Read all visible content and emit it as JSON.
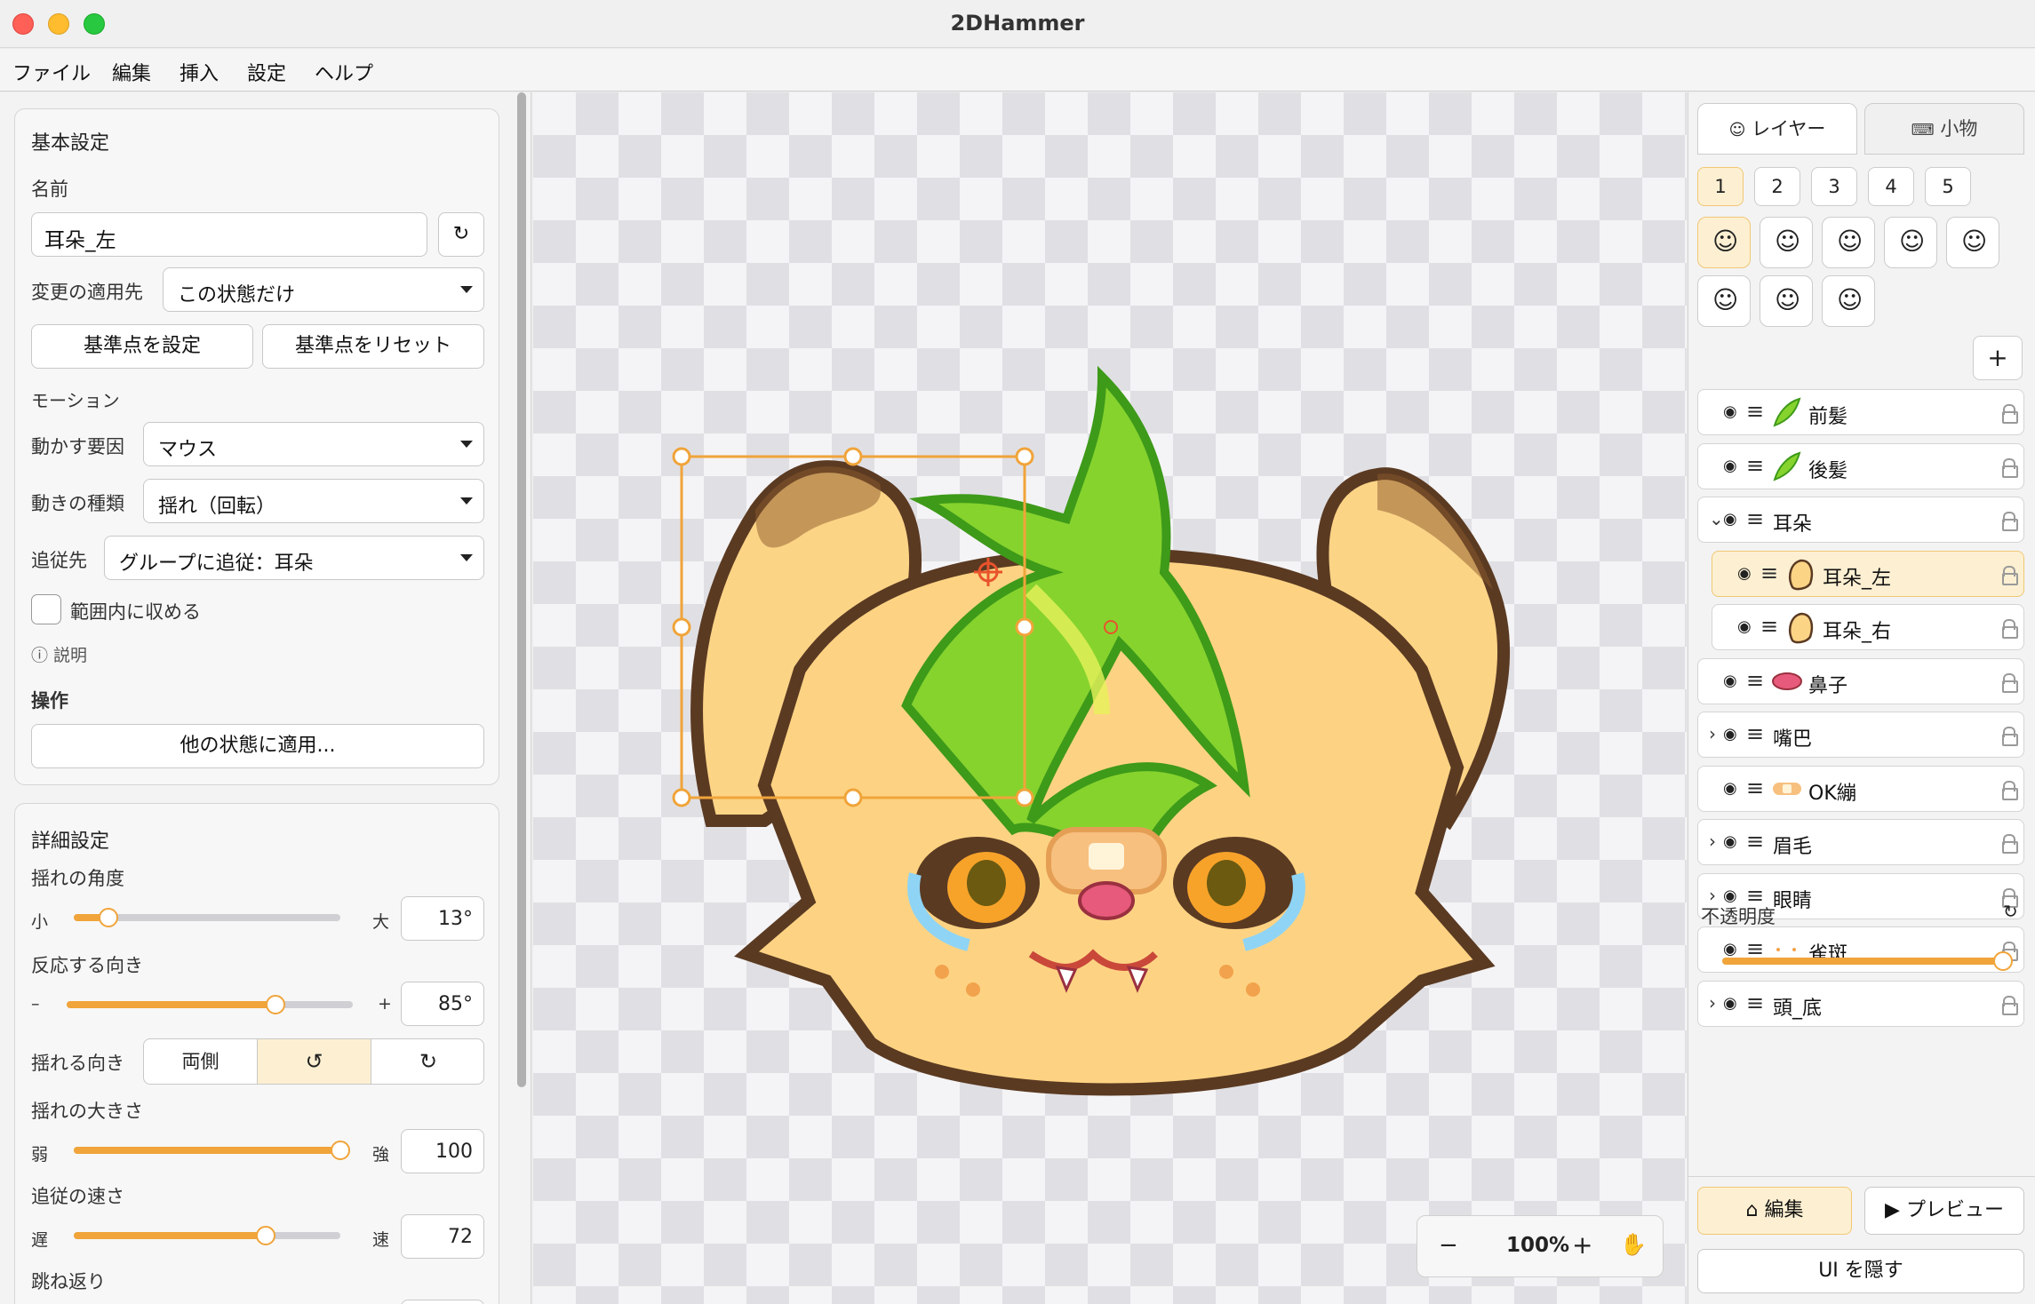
{
  "window": {
    "title": "2DHammer"
  },
  "menu": [
    "ファイル",
    "編集",
    "挿入",
    "設定",
    "ヘルプ"
  ],
  "basic": {
    "header": "基本設定",
    "name_label": "名前",
    "name_value": "耳朵_左",
    "apply_label": "変更の適用先",
    "apply_value": "この状態だけ",
    "set_anchor": "基準点を設定",
    "reset_anchor": "基準点をリセット",
    "motion_label": "モーション",
    "driver_label": "動かす要因",
    "driver_value": "マウス",
    "type_label": "動きの種類",
    "type_value": "揺れ（回転）",
    "follow_label": "追従先",
    "follow_value": "グループに追従：耳朵",
    "clamp_label": "範囲内に収める",
    "clamp_checked": false,
    "info_label": "ⓘ 説明",
    "ops_label": "操作",
    "apply_other": "他の状態に適用..."
  },
  "detail": {
    "header": "詳細設定",
    "angle": {
      "label": "揺れの角度",
      "min": "小",
      "max": "大",
      "value": "13°",
      "fraction": 0.13
    },
    "direction": {
      "label": "反応する向き",
      "min": "–",
      "max": "+",
      "value": "85°",
      "fraction": 0.73
    },
    "swing_dir": {
      "label": "揺れる向き",
      "options": [
        "両側",
        "↺",
        "↻"
      ],
      "selected": 1
    },
    "size": {
      "label": "揺れの大きさ",
      "min": "弱",
      "max": "強",
      "value": "100",
      "fraction": 1.0
    },
    "speed": {
      "label": "追従の速さ",
      "min": "遅",
      "max": "速",
      "value": "72",
      "fraction": 0.72
    },
    "bounce": {
      "label": "跳ね返り"
    }
  },
  "canvas": {
    "zoom": "100%"
  },
  "right": {
    "tabs": [
      "レイヤー",
      "小物"
    ],
    "active_tab": 0,
    "states": [
      "1",
      "2",
      "3",
      "4",
      "5"
    ],
    "active_state": 0,
    "add": "+",
    "layers": [
      {
        "name": "前髪",
        "indent": 0,
        "expand": "",
        "thumb": "leaf-green"
      },
      {
        "name": "後髪",
        "indent": 0,
        "expand": "",
        "thumb": "leaf-green"
      },
      {
        "name": "耳朵",
        "indent": 0,
        "expand": "⌄",
        "thumb": ""
      },
      {
        "name": "耳朵_左",
        "indent": 1,
        "expand": "",
        "thumb": "ear",
        "active": true
      },
      {
        "name": "耳朵_右",
        "indent": 1,
        "expand": "",
        "thumb": "ear"
      },
      {
        "name": "鼻子",
        "indent": 0,
        "expand": "",
        "thumb": "nose"
      },
      {
        "name": "嘴巴",
        "indent": 0,
        "expand": "›",
        "thumb": ""
      },
      {
        "name": "OK繃",
        "indent": 0,
        "expand": "",
        "thumb": "bandage"
      },
      {
        "name": "眉毛",
        "indent": 0,
        "expand": "›",
        "thumb": ""
      },
      {
        "name": "眼睛",
        "indent": 0,
        "expand": "›",
        "thumb": ""
      },
      {
        "name": "雀斑",
        "indent": 0,
        "expand": "",
        "thumb": "freckles"
      },
      {
        "name": "頭_底",
        "indent": 0,
        "expand": "›",
        "thumb": ""
      }
    ],
    "opacity_label": "不透明度",
    "opacity": 1.0,
    "edit": "編集",
    "preview": "プレビュー",
    "hide_ui": "UI を隠す"
  },
  "colors": {
    "accent": "#f0a43a",
    "accent_bg": "#fdf0d2"
  }
}
